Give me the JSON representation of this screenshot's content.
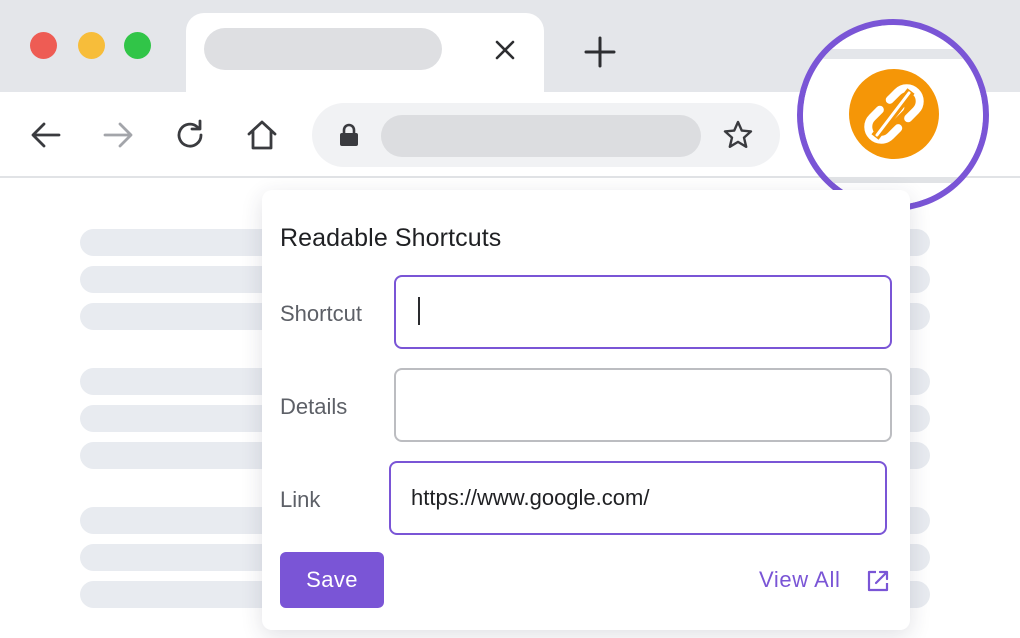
{
  "colors": {
    "accent": "#7a55d6",
    "extension_orange": "#f59607",
    "chrome_gray": "#e4e6ea",
    "placeholder_gray": "#e8ebf0",
    "traffic_red": "#ee5c54",
    "traffic_yellow": "#f7bd3a",
    "traffic_green": "#31c548"
  },
  "browser": {
    "icons": {
      "tab_close": "close-icon",
      "new_tab": "plus-icon",
      "back": "arrow-left-icon",
      "forward": "arrow-right-icon",
      "reload": "reload-icon",
      "home": "home-icon",
      "lock": "lock-icon",
      "bookmark": "star-icon",
      "extension": "broken-link-icon"
    }
  },
  "popup": {
    "title": "Readable Shortcuts",
    "fields": {
      "shortcut": {
        "label": "Shortcut",
        "value": ""
      },
      "details": {
        "label": "Details",
        "value": ""
      },
      "link": {
        "label": "Link",
        "value": "https://www.google.com/"
      }
    },
    "save_label": "Save",
    "view_all_label": "View All",
    "view_all_icon": "external-link-icon"
  }
}
